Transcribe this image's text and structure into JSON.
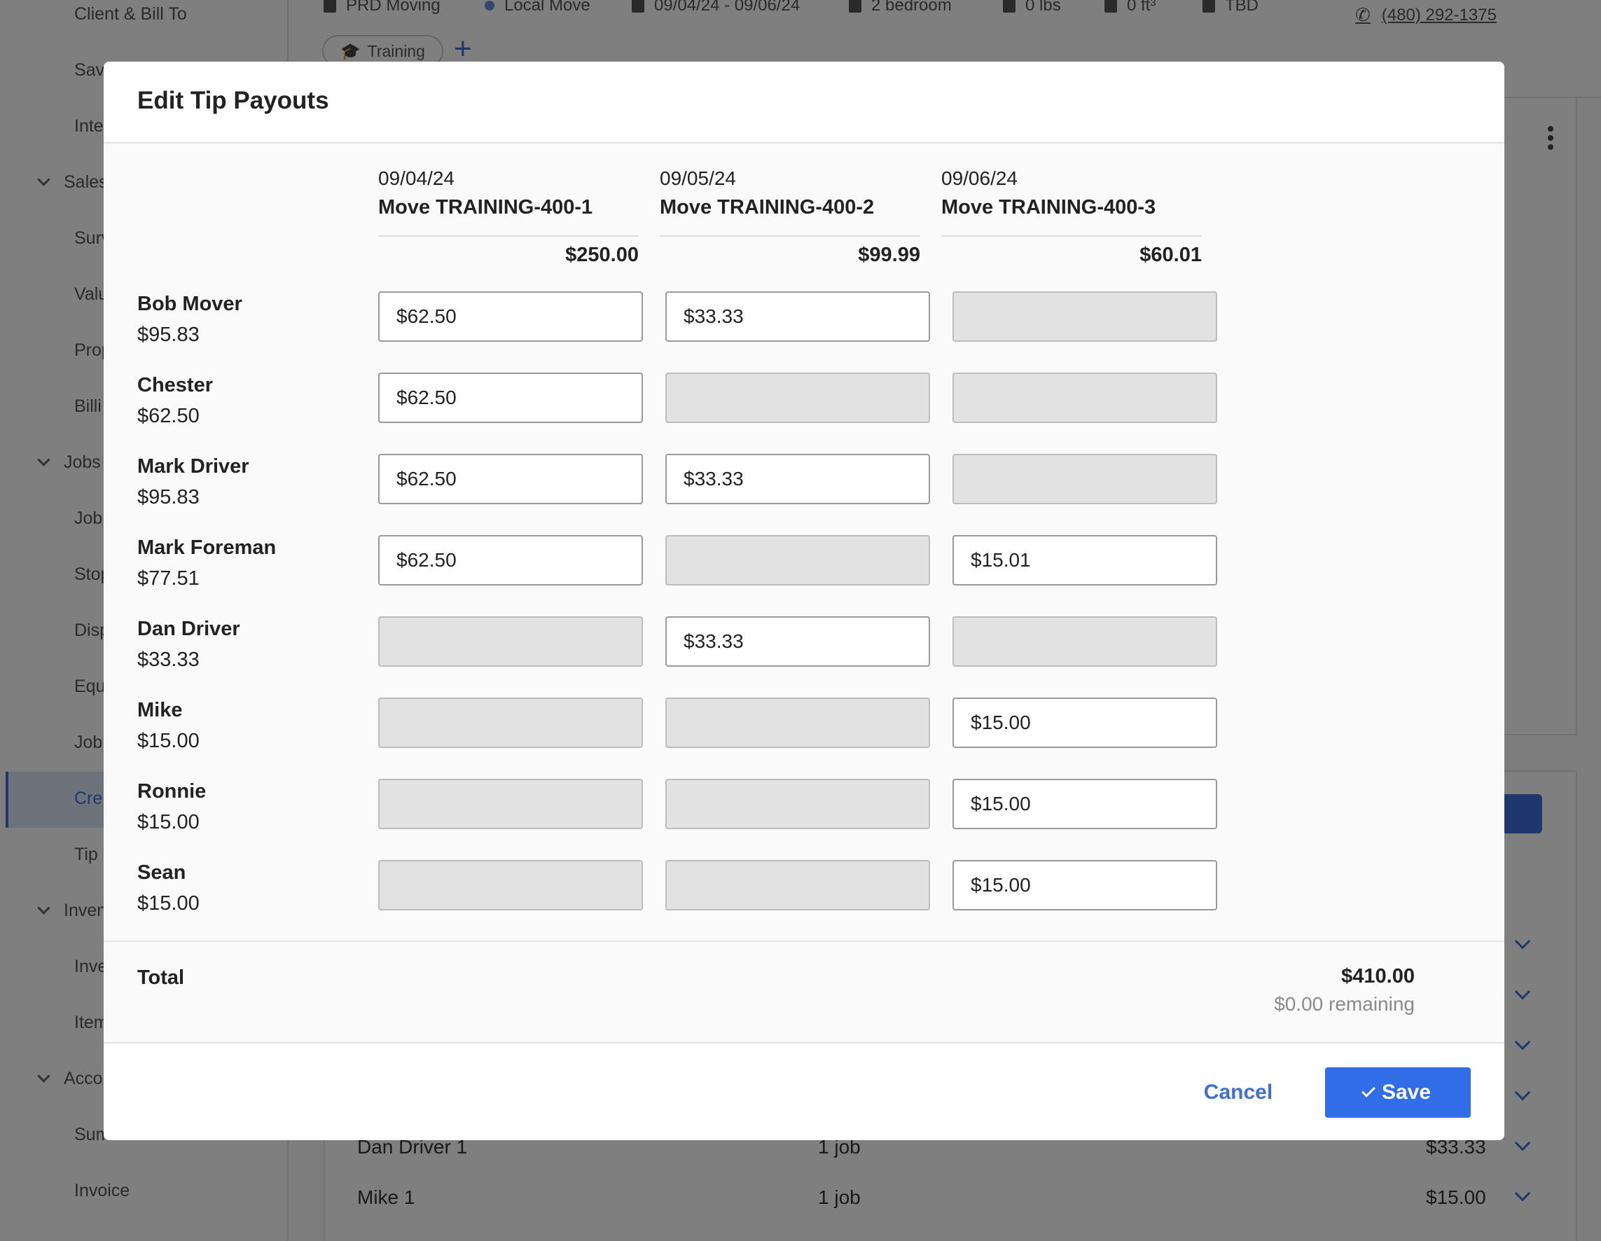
{
  "background": {
    "sidebar": {
      "items": [
        "Client & Bill To",
        "Sav",
        "Inte",
        "Surv",
        "Valu",
        "Prop",
        "Billi",
        "Job",
        "Stop",
        "Disp",
        "Equ",
        "Job",
        "Tip",
        "Inve",
        "Item",
        "Sum",
        "Invoice"
      ],
      "sections": [
        "Sales",
        "Jobs",
        "Inven",
        "Acco"
      ],
      "active_item": "Cre"
    },
    "meta": {
      "company": "PRD Moving",
      "move_type": "Local Move",
      "dates": "09/04/24 - 09/06/24",
      "size": "2 bedroom",
      "weight": "0 lbs",
      "volume": "0 ft³",
      "location": "TBD",
      "phone": "(480) 292-1375"
    },
    "tag": "Training",
    "rows": [
      {
        "name": "Dan Driver 1",
        "jobs": "1 job",
        "amount": "$33.33"
      },
      {
        "name": "Mike 1",
        "jobs": "1 job",
        "amount": "$15.00"
      }
    ]
  },
  "modal": {
    "title": "Edit Tip Payouts",
    "columns": [
      {
        "date": "09/04/24",
        "name": "Move TRAINING-400-1",
        "total": "$250.00"
      },
      {
        "date": "09/05/24",
        "name": "Move TRAINING-400-2",
        "total": "$99.99"
      },
      {
        "date": "09/06/24",
        "name": "Move TRAINING-400-3",
        "total": "$60.01"
      }
    ],
    "crew": [
      {
        "name": "Bob Mover",
        "total": "$95.83",
        "cells": [
          "$62.50",
          "$33.33",
          ""
        ]
      },
      {
        "name": "Chester",
        "total": "$62.50",
        "cells": [
          "$62.50",
          "",
          ""
        ]
      },
      {
        "name": "Mark Driver",
        "total": "$95.83",
        "cells": [
          "$62.50",
          "$33.33",
          ""
        ]
      },
      {
        "name": "Mark Foreman",
        "total": "$77.51",
        "cells": [
          "$62.50",
          "",
          "$15.01"
        ]
      },
      {
        "name": "Dan Driver",
        "total": "$33.33",
        "cells": [
          "",
          "$33.33",
          ""
        ]
      },
      {
        "name": "Mike",
        "total": "$15.00",
        "cells": [
          "",
          "",
          "$15.00"
        ]
      },
      {
        "name": "Ronnie",
        "total": "$15.00",
        "cells": [
          "",
          "",
          "$15.00"
        ]
      },
      {
        "name": "Sean",
        "total": "$15.00",
        "cells": [
          "",
          "",
          "$15.00"
        ]
      }
    ],
    "total_label": "Total",
    "total_amount": "$410.00",
    "remaining": "$0.00 remaining",
    "cancel_label": "Cancel",
    "save_label": "Save"
  }
}
